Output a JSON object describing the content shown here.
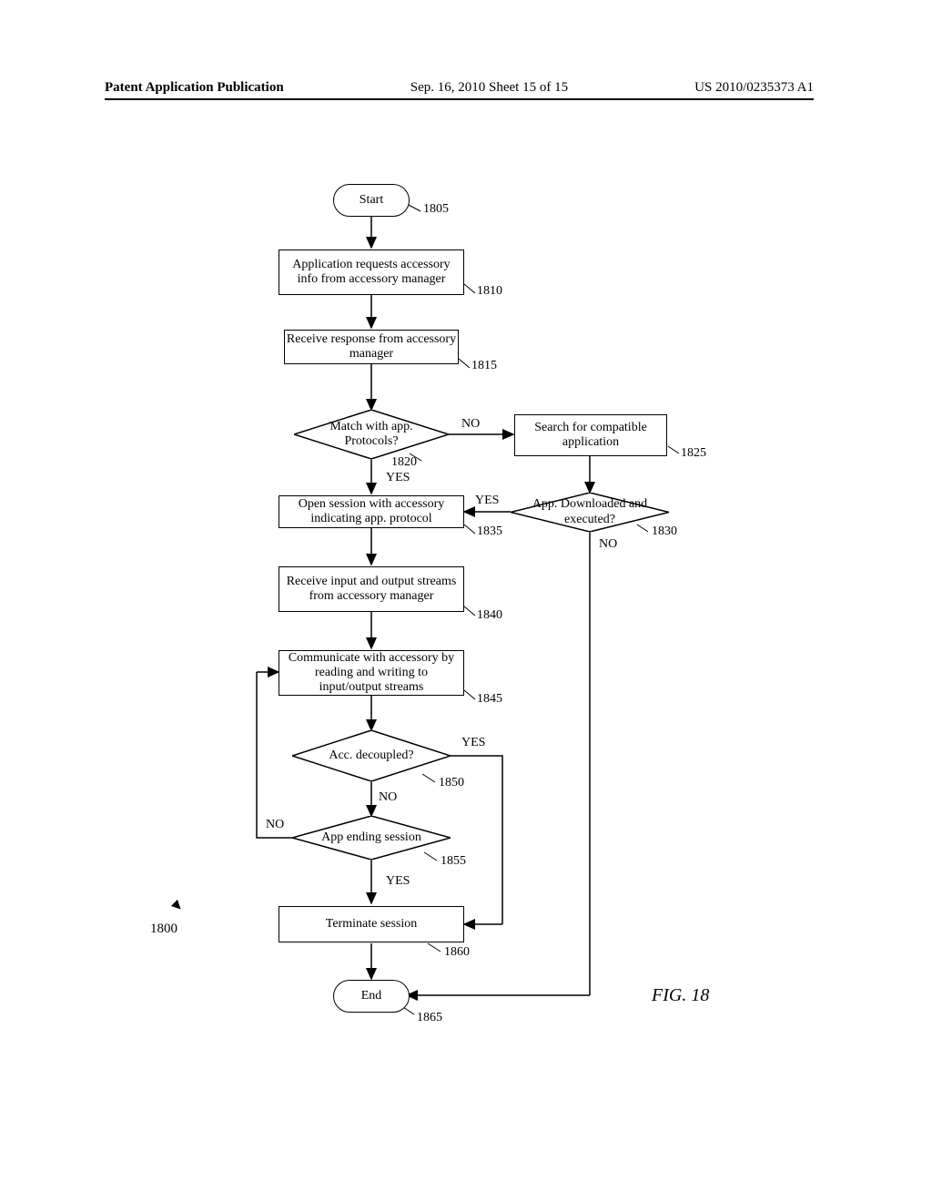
{
  "header": {
    "left": "Patent Application Publication",
    "middle": "Sep. 16, 2010  Sheet 15 of 15",
    "right": "US 2010/0235373 A1"
  },
  "nodes": {
    "start": {
      "text": "Start",
      "ref": "1805"
    },
    "n1810": {
      "text": "Application requests accessory info from accessory manager",
      "ref": "1810"
    },
    "n1815": {
      "text": "Receive response from accessory manager",
      "ref": "1815"
    },
    "n1820": {
      "text": "Match with app. Protocols?",
      "ref": "1820",
      "yes": "YES",
      "no": "NO"
    },
    "n1825": {
      "text": "Search for compatible application",
      "ref": "1825"
    },
    "n1830": {
      "text": "App. Downloaded and executed?",
      "ref": "1830",
      "yes": "YES",
      "no": "NO"
    },
    "n1835": {
      "text": "Open session with accessory indicating app. protocol",
      "ref": "1835"
    },
    "n1840": {
      "text": "Receive input and output streams from accessory manager",
      "ref": "1840"
    },
    "n1845": {
      "text": "Communicate with accessory by reading and writing to input/output streams",
      "ref": "1845"
    },
    "n1850": {
      "text": "Acc. decoupled?",
      "ref": "1850",
      "yes": "YES",
      "no": "NO"
    },
    "n1855": {
      "text": "App ending session",
      "ref": "1855",
      "yes": "YES",
      "no": "NO"
    },
    "n1860": {
      "text": "Terminate session",
      "ref": "1860"
    },
    "end": {
      "text": "End",
      "ref": "1865"
    }
  },
  "figure": {
    "label": "FIG. 18",
    "ref": "1800"
  },
  "chart_data": {
    "type": "flowchart",
    "title": "FIG. 18",
    "shapes": [
      {
        "id": "1805",
        "type": "terminator",
        "text": "Start"
      },
      {
        "id": "1810",
        "type": "process",
        "text": "Application requests accessory info from accessory manager"
      },
      {
        "id": "1815",
        "type": "process",
        "text": "Receive response from accessory manager"
      },
      {
        "id": "1820",
        "type": "decision",
        "text": "Match with app. Protocols?"
      },
      {
        "id": "1825",
        "type": "process",
        "text": "Search for compatible application"
      },
      {
        "id": "1830",
        "type": "decision",
        "text": "App. Downloaded and executed?"
      },
      {
        "id": "1835",
        "type": "process",
        "text": "Open session with accessory indicating app. protocol"
      },
      {
        "id": "1840",
        "type": "process",
        "text": "Receive input and output streams from accessory manager"
      },
      {
        "id": "1845",
        "type": "process",
        "text": "Communicate with accessory by reading and writing to input/output streams"
      },
      {
        "id": "1850",
        "type": "decision",
        "text": "Acc. decoupled?"
      },
      {
        "id": "1855",
        "type": "decision",
        "text": "App ending session"
      },
      {
        "id": "1860",
        "type": "process",
        "text": "Terminate session"
      },
      {
        "id": "1865",
        "type": "terminator",
        "text": "End"
      }
    ],
    "edges": [
      {
        "from": "1805",
        "to": "1810"
      },
      {
        "from": "1810",
        "to": "1815"
      },
      {
        "from": "1815",
        "to": "1820"
      },
      {
        "from": "1820",
        "to": "1835",
        "label": "YES"
      },
      {
        "from": "1820",
        "to": "1825",
        "label": "NO"
      },
      {
        "from": "1825",
        "to": "1830"
      },
      {
        "from": "1830",
        "to": "1835",
        "label": "YES"
      },
      {
        "from": "1830",
        "to": "1865",
        "label": "NO"
      },
      {
        "from": "1835",
        "to": "1840"
      },
      {
        "from": "1840",
        "to": "1845"
      },
      {
        "from": "1845",
        "to": "1850"
      },
      {
        "from": "1850",
        "to": "1860",
        "label": "YES"
      },
      {
        "from": "1850",
        "to": "1855",
        "label": "NO"
      },
      {
        "from": "1855",
        "to": "1860",
        "label": "YES"
      },
      {
        "from": "1855",
        "to": "1845",
        "label": "NO"
      },
      {
        "from": "1860",
        "to": "1865"
      }
    ]
  }
}
